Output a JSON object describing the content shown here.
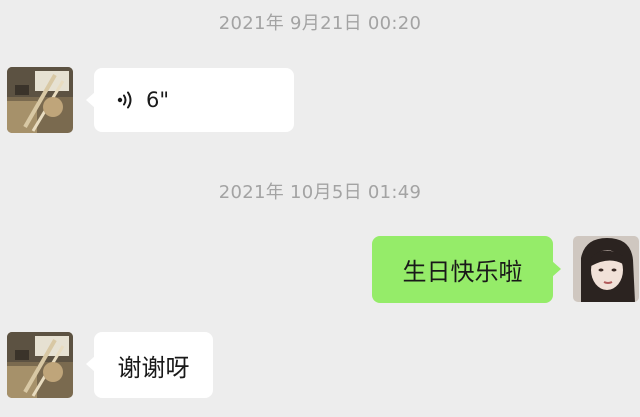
{
  "chat": {
    "messages": [
      {
        "timestamp": "2021年 9月21日 00:20",
        "sender": "contact",
        "type": "voice",
        "icon": "voice-waves-icon",
        "duration": "6\""
      },
      {
        "timestamp": "2021年 10月5日 01:49",
        "sender": "me",
        "type": "text",
        "text": "生日快乐啦"
      },
      {
        "sender": "contact",
        "type": "text",
        "text": "谢谢呀"
      }
    ]
  },
  "colors": {
    "background": "#ededed",
    "sent_bubble": "#95ec69",
    "received_bubble": "#ffffff",
    "timestamp_text": "#a3a3a3"
  }
}
